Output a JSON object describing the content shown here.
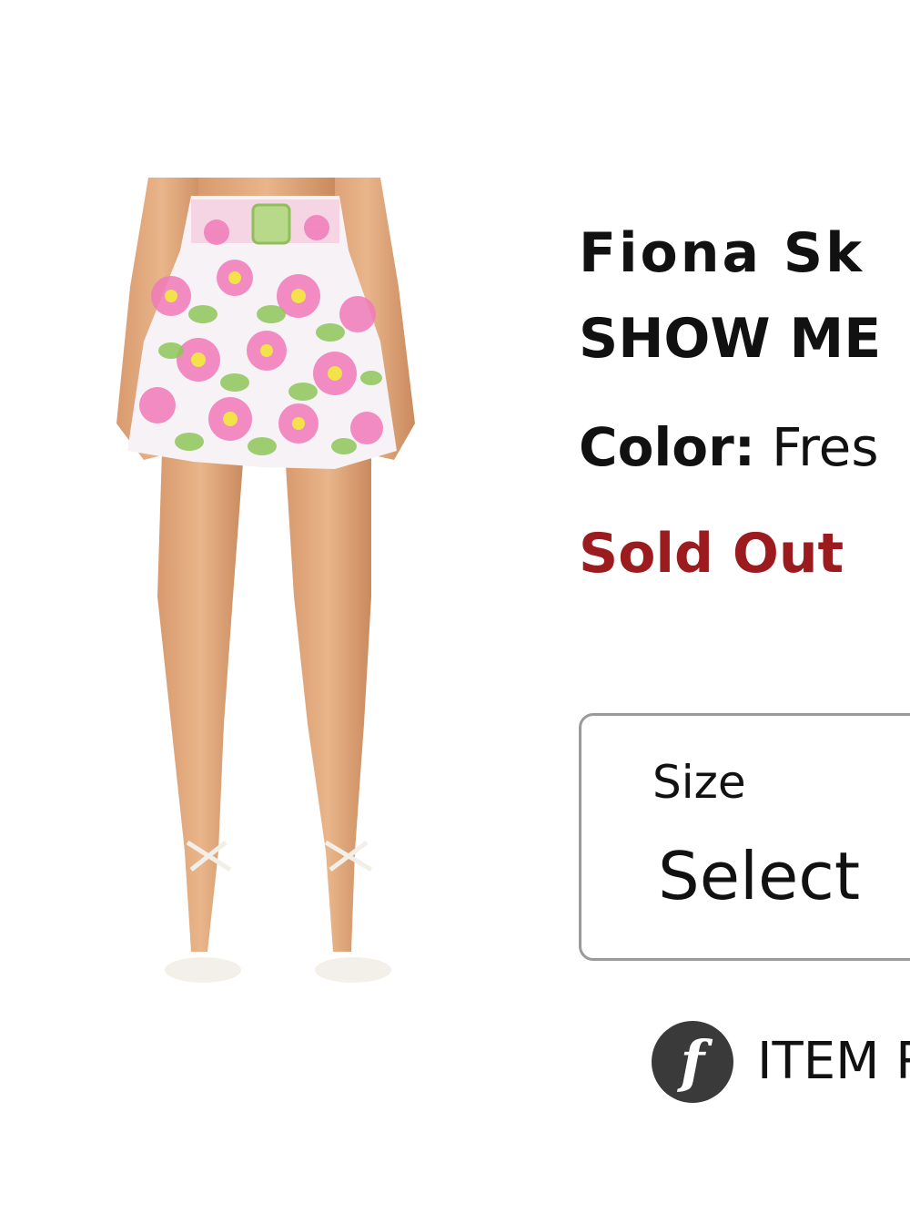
{
  "product": {
    "title": "Fiona Sk",
    "brand": "SHOW ME",
    "color_label": "Color:",
    "color_value": "Fres",
    "status": "Sold Out",
    "status_color": "#9b1b1f"
  },
  "size_select": {
    "label": "Size",
    "value": "Select"
  },
  "item_row": {
    "icon": "fit-f-icon",
    "icon_glyph": "f",
    "text": "ITEM R"
  }
}
